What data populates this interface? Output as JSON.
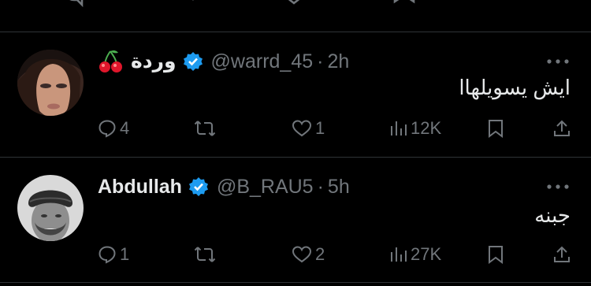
{
  "tweets": [
    {
      "display_name": "وردة",
      "handle": "@warrd_45",
      "separator": "·",
      "time": "2h",
      "text": "ايش يسويلهاا",
      "replies": "4",
      "reposts": "",
      "likes": "1",
      "views": "12K"
    },
    {
      "display_name": "Abdullah",
      "handle": "@B_RAU5",
      "separator": "·",
      "time": "5h",
      "text": "جبنه",
      "replies": "1",
      "reposts": "",
      "likes": "2",
      "views": "27K"
    }
  ],
  "icons": {
    "verified": "verified-badge-icon",
    "cherry": "cherry-emoji-icon",
    "reply": "reply-icon",
    "repost": "repost-icon",
    "like": "heart-icon",
    "views": "views-icon",
    "bookmark": "bookmark-icon",
    "share": "share-icon",
    "more": "more-icon"
  },
  "colors": {
    "background": "#000000",
    "text": "#e7e9ea",
    "secondary": "#71767b",
    "verified": "#1d9bf0",
    "divider": "#2f3336"
  }
}
